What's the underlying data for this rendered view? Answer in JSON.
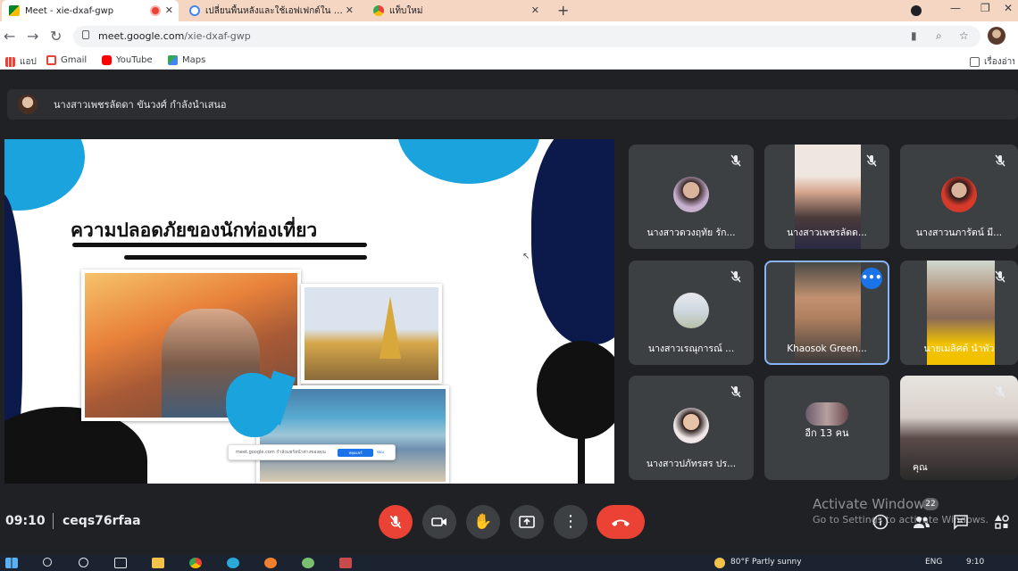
{
  "browser": {
    "tabs": [
      {
        "title": "Meet - xie-dxaf-gwp",
        "active": true
      },
      {
        "title": "เปลี่ยนพื้นหลังและใช้เอฟเฟกต์ใน Goo",
        "active": false
      },
      {
        "title": "แท็บใหม่",
        "active": false
      }
    ],
    "url_host": "meet.google.com",
    "url_path": "/xie-dxaf-gwp",
    "bookmarks": [
      "แอป",
      "Gmail",
      "YouTube",
      "Maps"
    ],
    "bookmarks_right": "เรื่องอ่านที่บุ๊กมาร์ก"
  },
  "meet": {
    "presenter_banner": "นางสาวเพชรลัดดา ขันวงศ์ กำลังนำเสนอ",
    "slide": {
      "title": "ความปลอดภัยของนักท่องเที่ยว",
      "url_popup": "meet.google.com กำลังแชร์หน้าต่างของคุณ",
      "url_popup_stop": "หยุดแชร์",
      "url_popup_hide": "ซ่อน"
    },
    "participants": [
      {
        "name": "นางสาวดวงฤทัย รัก...",
        "type": "avatar",
        "muted": true
      },
      {
        "name": "นางสาวเพชรลัดด...",
        "type": "video",
        "muted": true
      },
      {
        "name": "นางสาวนภารัตน์ มี...",
        "type": "avatar",
        "muted": true
      },
      {
        "name": "นางสาวเรณุการณ์ ...",
        "type": "avatar",
        "muted": true
      },
      {
        "name": "Khaosok Green...",
        "type": "video",
        "muted": false,
        "active": true
      },
      {
        "name": "นายเมลิศต์ นำพัว",
        "type": "video",
        "muted": true
      },
      {
        "name": "นางสาวปภัทรสร ปร...",
        "type": "avatar",
        "muted": true
      },
      {
        "name": "อีก 13 คน",
        "type": "group",
        "muted": false
      },
      {
        "name": "คุณ",
        "type": "video",
        "muted": true
      }
    ],
    "time": "09:10",
    "meeting_code": "ceqs76rfaa",
    "activate_windows": "Activate Windows",
    "activate_hint": "Go to Settings to activate Windows.",
    "people_count": "22"
  },
  "taskbar": {
    "weather": "80°F  Partly sunny",
    "lang": "ENG",
    "clock": "9:10"
  },
  "colors": {
    "meet_bg": "#202124",
    "tile_bg": "#3c4043",
    "red": "#ea4335",
    "accent": "#8ab4f8",
    "slide_blue": "#1aa3dc",
    "slide_navy": "#0b1a4a"
  }
}
